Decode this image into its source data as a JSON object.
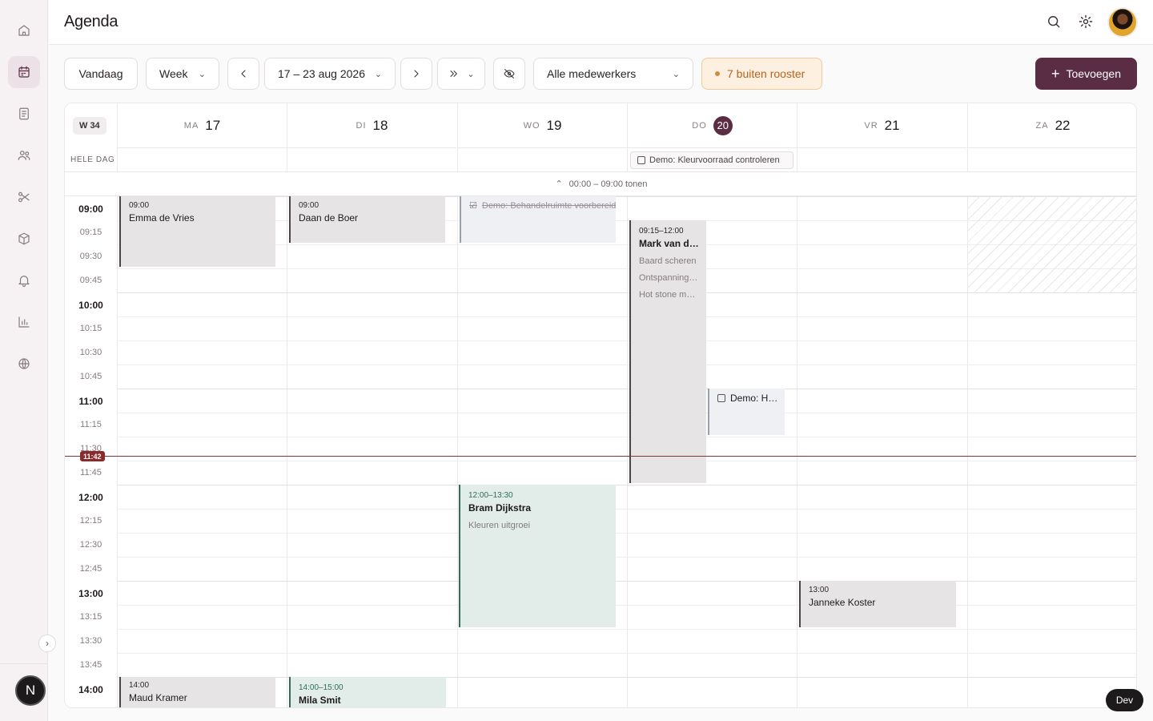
{
  "app": {
    "title": "Agenda"
  },
  "sidebar": {
    "items": [
      {
        "icon": "home-icon"
      },
      {
        "icon": "calendar-icon"
      },
      {
        "icon": "document-icon"
      },
      {
        "icon": "users-icon"
      },
      {
        "icon": "scissors-icon"
      },
      {
        "icon": "package-icon"
      },
      {
        "icon": "bell-icon"
      },
      {
        "icon": "chart-icon"
      },
      {
        "icon": "globe-icon"
      }
    ],
    "active": "calendar",
    "user_initial": "N"
  },
  "header": {
    "search_icon": "search-icon",
    "settings_icon": "gear-icon",
    "avatar": "avatar"
  },
  "toolbar": {
    "today_label": "Vandaag",
    "view_label": "Week",
    "range_label": "17 – 23 aug 2026",
    "staff_label": "Alle medewerkers",
    "out_of_schedule_label": "7 buiten rooster",
    "add_label": "Toevoegen"
  },
  "calendar": {
    "week_label": "W 34",
    "allday_label": "HELE DAG",
    "earlier_label": "00:00 – 09:00 tonen",
    "days": [
      {
        "name": "MA",
        "num": "17",
        "today": false
      },
      {
        "name": "DI",
        "num": "18",
        "today": false
      },
      {
        "name": "WO",
        "num": "19",
        "today": false
      },
      {
        "name": "DO",
        "num": "20",
        "today": true
      },
      {
        "name": "VR",
        "num": "21",
        "today": false
      },
      {
        "name": "ZA",
        "num": "22",
        "today": false
      }
    ],
    "allday_events": [
      {
        "day": 3,
        "title": "Demo: Kleurvoorraad controleren"
      }
    ],
    "time_labels": [
      "09:00",
      "09:15",
      "09:30",
      "09:45",
      "10:00",
      "10:15",
      "10:30",
      "10:45",
      "11:00",
      "11:15",
      "11:30",
      "11:45",
      "12:00",
      "12:15",
      "12:30",
      "12:45",
      "13:00",
      "13:15",
      "13:30",
      "13:45",
      "14:00"
    ],
    "now_label": "11:42",
    "events": [
      {
        "day": 0,
        "time": "09:00",
        "title": "Emma de Vries"
      },
      {
        "day": 1,
        "time": "09:00",
        "title": "Daan de Boer"
      },
      {
        "day": 2,
        "title": "Demo: Behandelruimte voorbereiden",
        "task": true,
        "done": true
      },
      {
        "day": 3,
        "time": "09:15–12:00",
        "title": "Mark van den Berg",
        "subs": [
          "Baard scheren",
          "Ontspanningsmassage",
          "Hot stone massage"
        ]
      },
      {
        "day": 3,
        "title": "Demo: Handdoeken wassen",
        "task": true,
        "done": false
      },
      {
        "day": 2,
        "time": "12:00–13:30",
        "title": "Bram Dijkstra",
        "subs": [
          "Kleuren uitgroei"
        ]
      },
      {
        "day": 4,
        "time": "13:00",
        "title": "Janneke Koster"
      },
      {
        "day": 0,
        "time": "14:00",
        "title": "Maud Kramer"
      },
      {
        "day": 1,
        "time": "14:00–15:00",
        "title": "Mila Smit"
      }
    ]
  },
  "dev_badge": "Dev"
}
